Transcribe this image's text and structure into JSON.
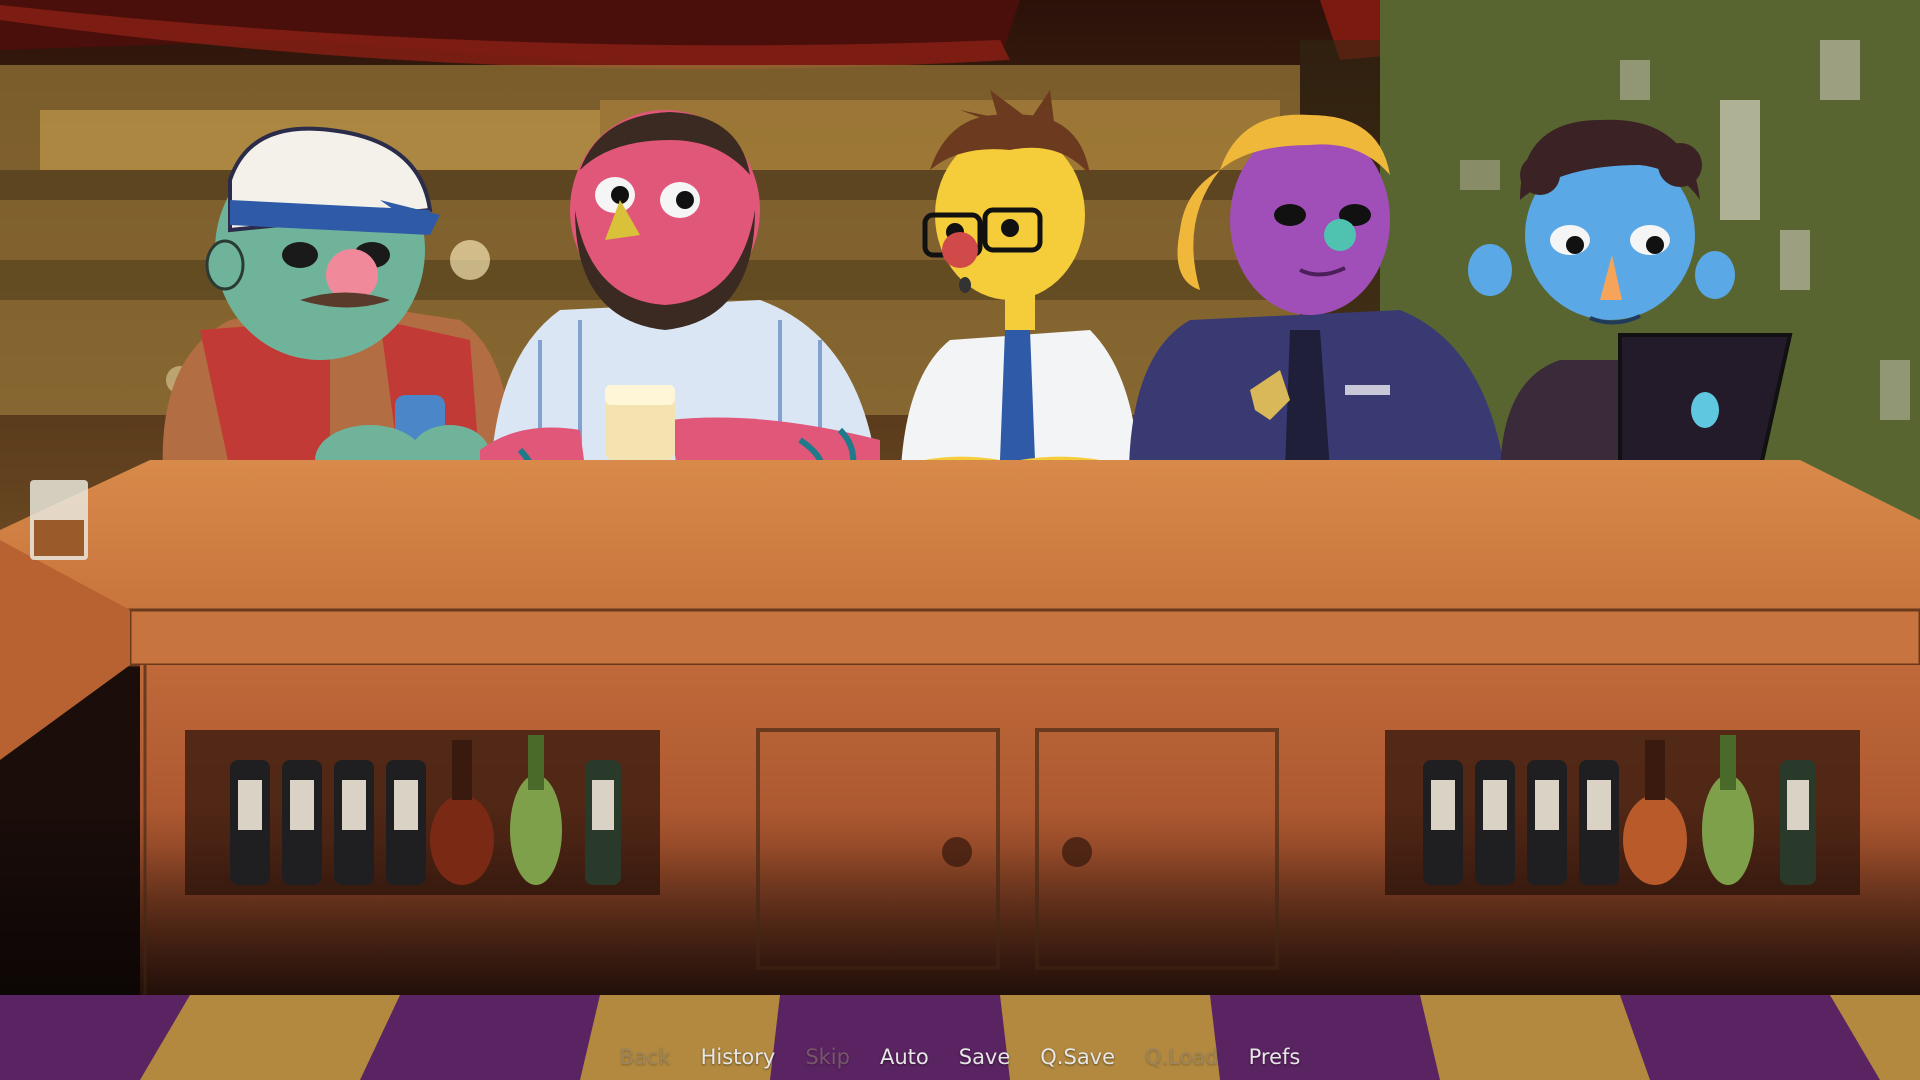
{
  "quick_menu": {
    "items": [
      {
        "label": "Back",
        "enabled": false
      },
      {
        "label": "History",
        "enabled": true
      },
      {
        "label": "Skip",
        "enabled": false
      },
      {
        "label": "Auto",
        "enabled": true
      },
      {
        "label": "Save",
        "enabled": true
      },
      {
        "label": "Q.Save",
        "enabled": true
      },
      {
        "label": "Q.Load",
        "enabled": false
      },
      {
        "label": "Prefs",
        "enabled": true
      }
    ]
  },
  "scene": {
    "location": "bar",
    "characters": [
      {
        "name": "trucker-cap-green-character",
        "color": "#6fb39a"
      },
      {
        "name": "tattooed-bearded-pink-character",
        "color": "#e0577a"
      },
      {
        "name": "yellow-glasses-tie-character",
        "color": "#f5cc3a"
      },
      {
        "name": "purple-police-officer-character",
        "color": "#a14fb8"
      },
      {
        "name": "blue-laptop-character",
        "color": "#5aa9e6"
      }
    ],
    "colors": {
      "bar_counter": "#c9733e",
      "floor_purple": "#6a2a73",
      "floor_gold": "#d2a24a",
      "wall_dark": "#3a1c12"
    }
  }
}
